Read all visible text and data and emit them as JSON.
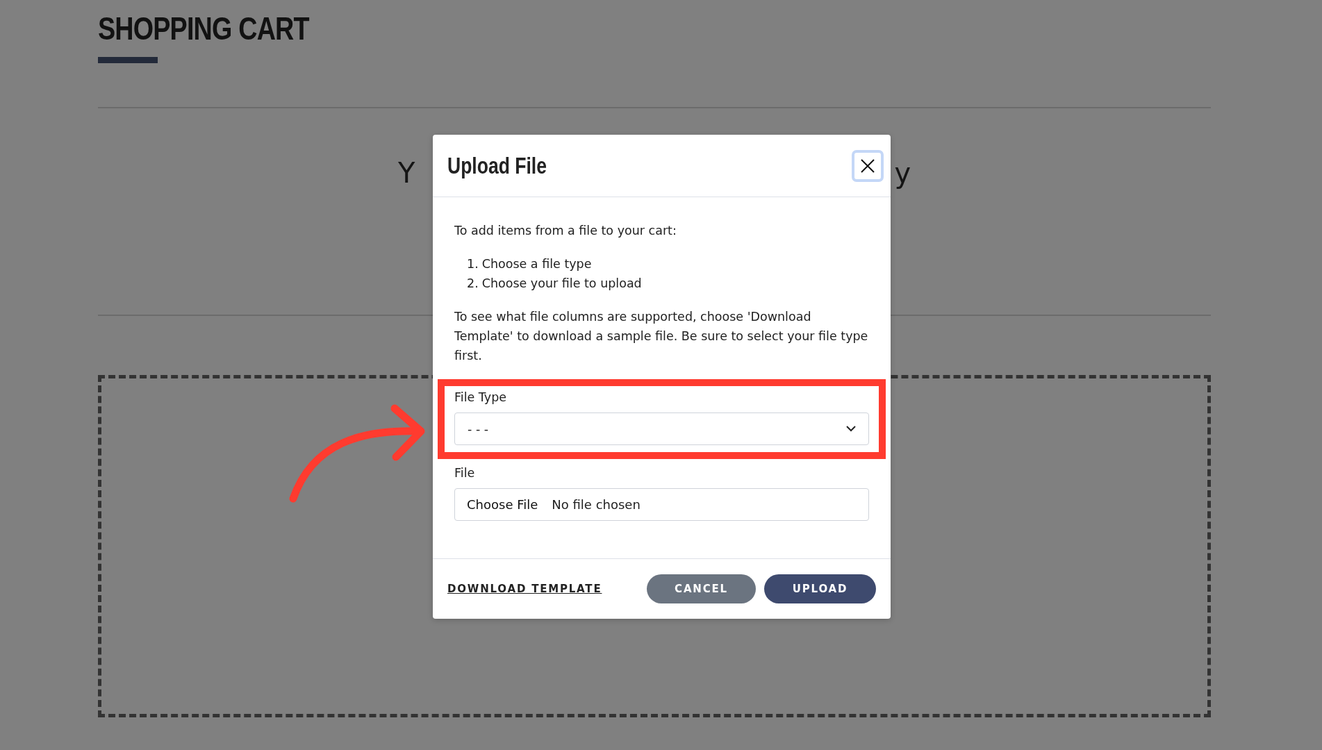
{
  "page": {
    "title": "SHOPPING CART",
    "message_left": "Y",
    "message_right": "y"
  },
  "annotation": {
    "kind": "arrow-and-frame"
  },
  "dialog": {
    "title": "Upload File",
    "intro": "To add items from a file to your cart:",
    "steps": [
      {
        "number": "1.",
        "text": "Choose a file type"
      },
      {
        "number": "2.",
        "text": "Choose your file to upload"
      }
    ],
    "note": "To see what file columns are supported, choose 'Download Template' to download a sample file. Be sure to select your file type first.",
    "file_type": {
      "label": "File Type",
      "value": "- - -"
    },
    "file": {
      "label": "File",
      "button": "Choose File",
      "status": "No file chosen"
    },
    "download_link": "DOWNLOAD TEMPLATE",
    "buttons": [
      {
        "label": "CANCEL",
        "kind": "secondary"
      },
      {
        "label": "UPLOAD",
        "kind": "primary"
      }
    ]
  }
}
